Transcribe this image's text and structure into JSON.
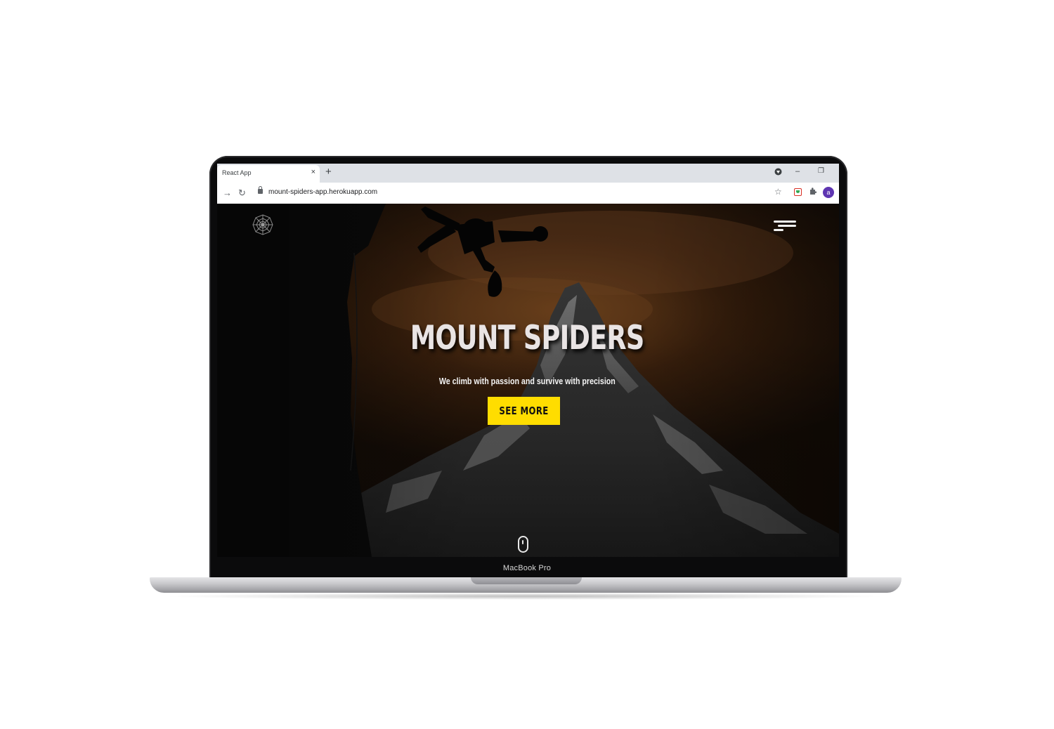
{
  "device": {
    "label": "MacBook Pro"
  },
  "browser": {
    "tab_title": "React App",
    "tab_close": "×",
    "new_tab": "+",
    "url": "mount-spiders-app.herokuapp.com",
    "profile_initial": "a",
    "controls": {
      "minimize": "–",
      "restore": "❐"
    }
  },
  "site": {
    "title": "MOUNT SPIDERS",
    "tagline": "We climb with passion and survive with precision",
    "cta_label": "SEE MORE"
  },
  "colors": {
    "cta_background": "#ffdd00",
    "avatar": "#5e35b1"
  }
}
